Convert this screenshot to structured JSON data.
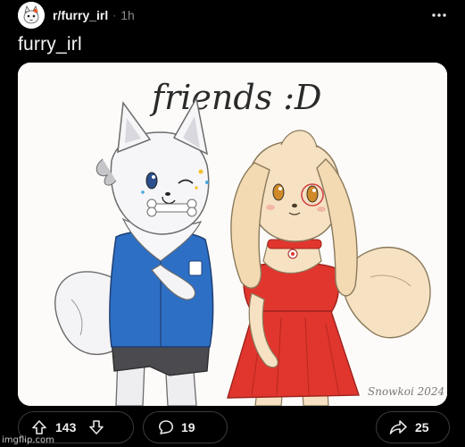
{
  "post": {
    "subreddit": "r/furry_irl",
    "separator": "·",
    "age": "1h",
    "title": "furry_irl"
  },
  "image": {
    "caption": "friends :D",
    "signature": "Snowkoi 2024"
  },
  "actions": {
    "upvotes": "143",
    "comments": "19",
    "shares": "25"
  },
  "footer": {
    "watermark": "imgflip.com"
  },
  "icons": {
    "avatar": "subreddit-avatar-icon",
    "more": "more-options-icon",
    "upvote": "upvote-arrow-icon",
    "downvote": "downvote-arrow-icon",
    "comment": "comment-bubble-icon",
    "share": "share-arrow-icon"
  },
  "colors": {
    "background": "#000000",
    "pill_border": "#3b3b3b",
    "image_bg": "#fcfbf9",
    "vest_blue": "#2d6fc4",
    "skirt_red": "#e0362e",
    "cream_fur": "#f6e2c2"
  }
}
